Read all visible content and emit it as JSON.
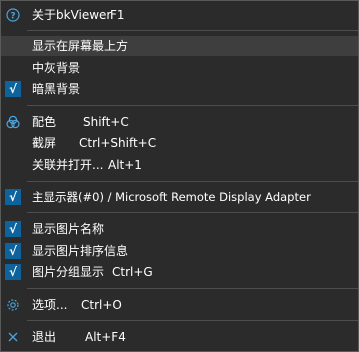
{
  "menu": {
    "about": {
      "label": "关于bkViewer",
      "shortcut": "F1",
      "icon": "help-circle-icon"
    },
    "show_top": {
      "label": "显示在屏幕最上方"
    },
    "gray_bg": {
      "label": "中灰背景"
    },
    "dark_bg": {
      "label": "暗黑背景",
      "checked": true
    },
    "color": {
      "label": "配色",
      "shortcut": "Shift+C",
      "icon": "palette-icon"
    },
    "screenshot": {
      "label": "截屏",
      "shortcut": "Ctrl+Shift+C"
    },
    "open_with": {
      "label": "关联并打开...",
      "shortcut": "Alt+1"
    },
    "display": {
      "label": "主显示器(#0) / Microsoft Remote Display Adapter",
      "checked": true
    },
    "show_name": {
      "label": "显示图片名称",
      "checked": true
    },
    "show_sort": {
      "label": "显示图片排序信息",
      "checked": true
    },
    "group": {
      "label": "图片分组显示",
      "shortcut": "Ctrl+G",
      "checked": true
    },
    "options": {
      "label": "选项...",
      "shortcut": "Ctrl+O",
      "icon": "gear-icon"
    },
    "exit": {
      "label": "退出",
      "shortcut": "Alt+F4",
      "icon": "close-icon"
    },
    "check_mark": "√"
  },
  "colors": {
    "background": "#2b2b2b",
    "highlight": "#3e3e3e",
    "check_bg": "#0e639c",
    "icon_blue": "#4aa3df"
  }
}
